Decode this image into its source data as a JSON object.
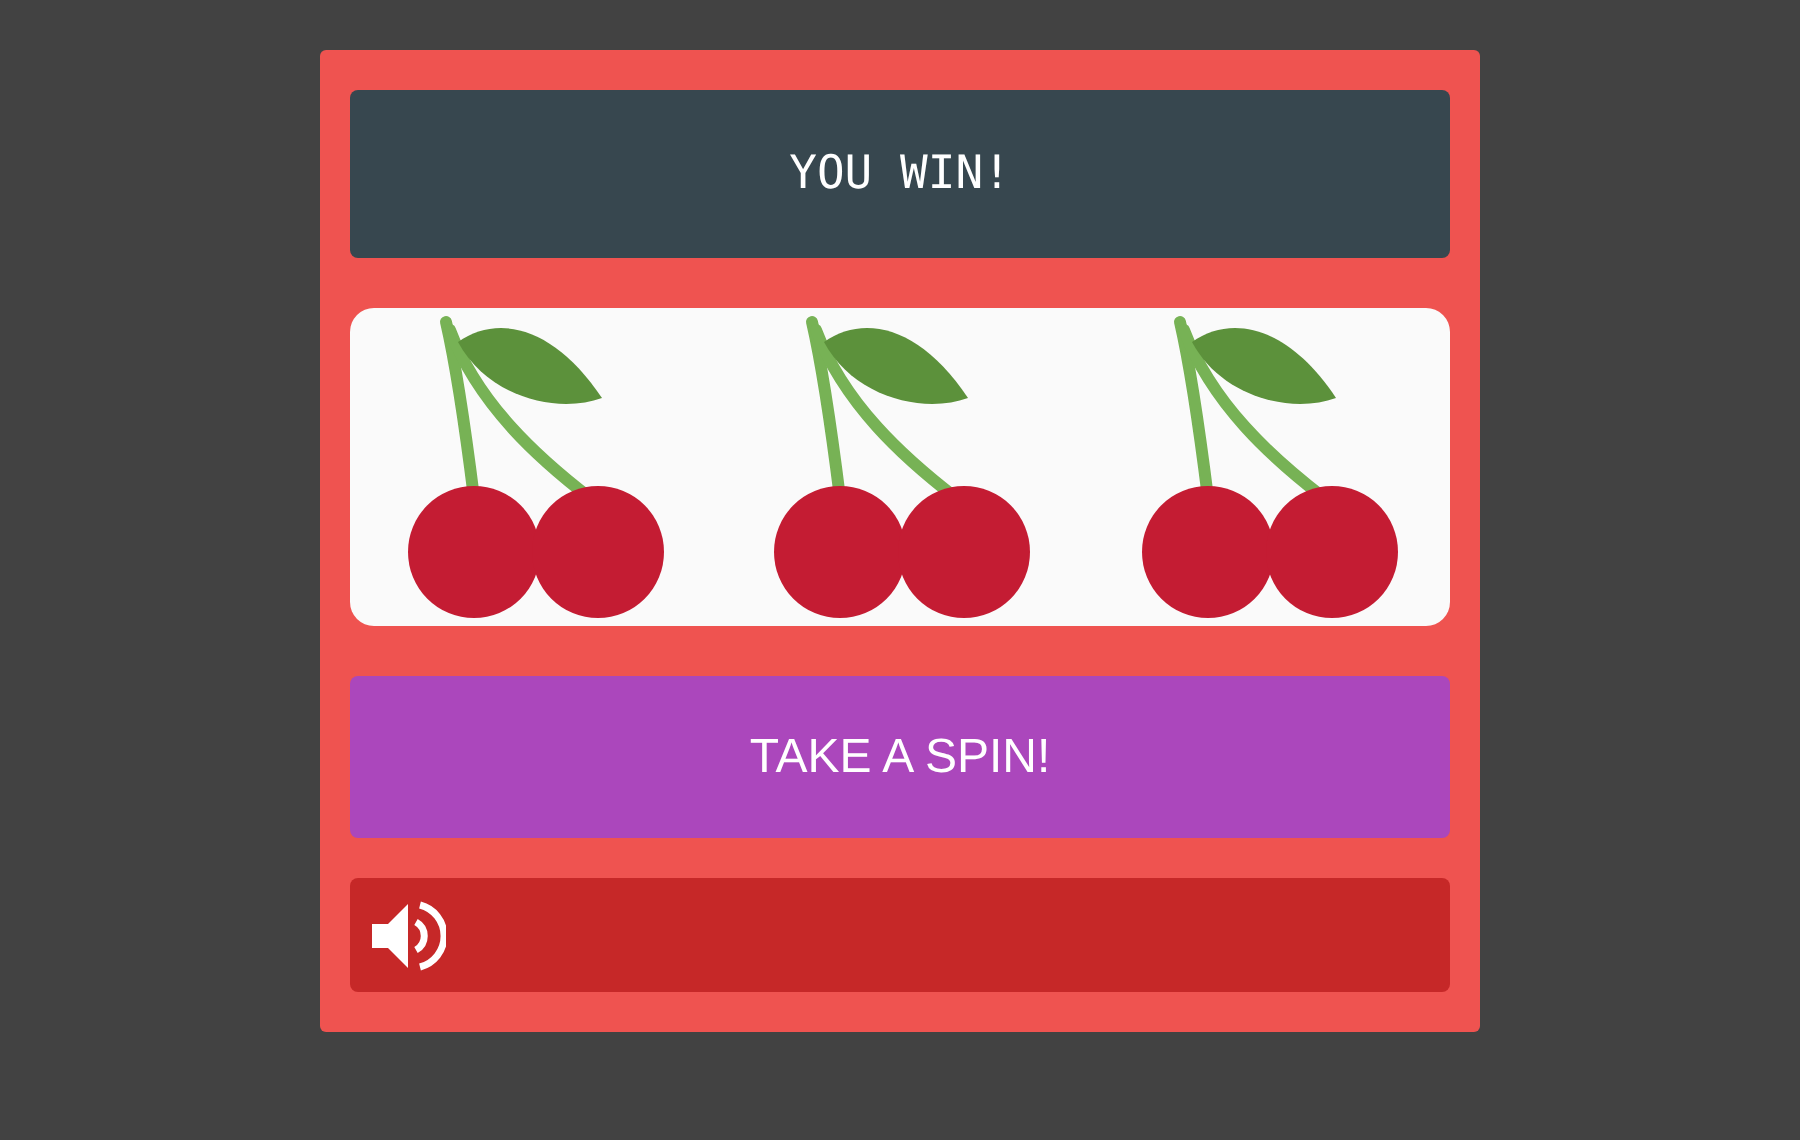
{
  "banner": {
    "text": "YOU WIN!"
  },
  "reels": [
    {
      "kind": "cherry"
    },
    {
      "kind": "cherry"
    },
    {
      "kind": "cherry"
    }
  ],
  "spin_button": {
    "label": "TAKE A SPIN!"
  },
  "sound": {
    "muted": false
  }
}
